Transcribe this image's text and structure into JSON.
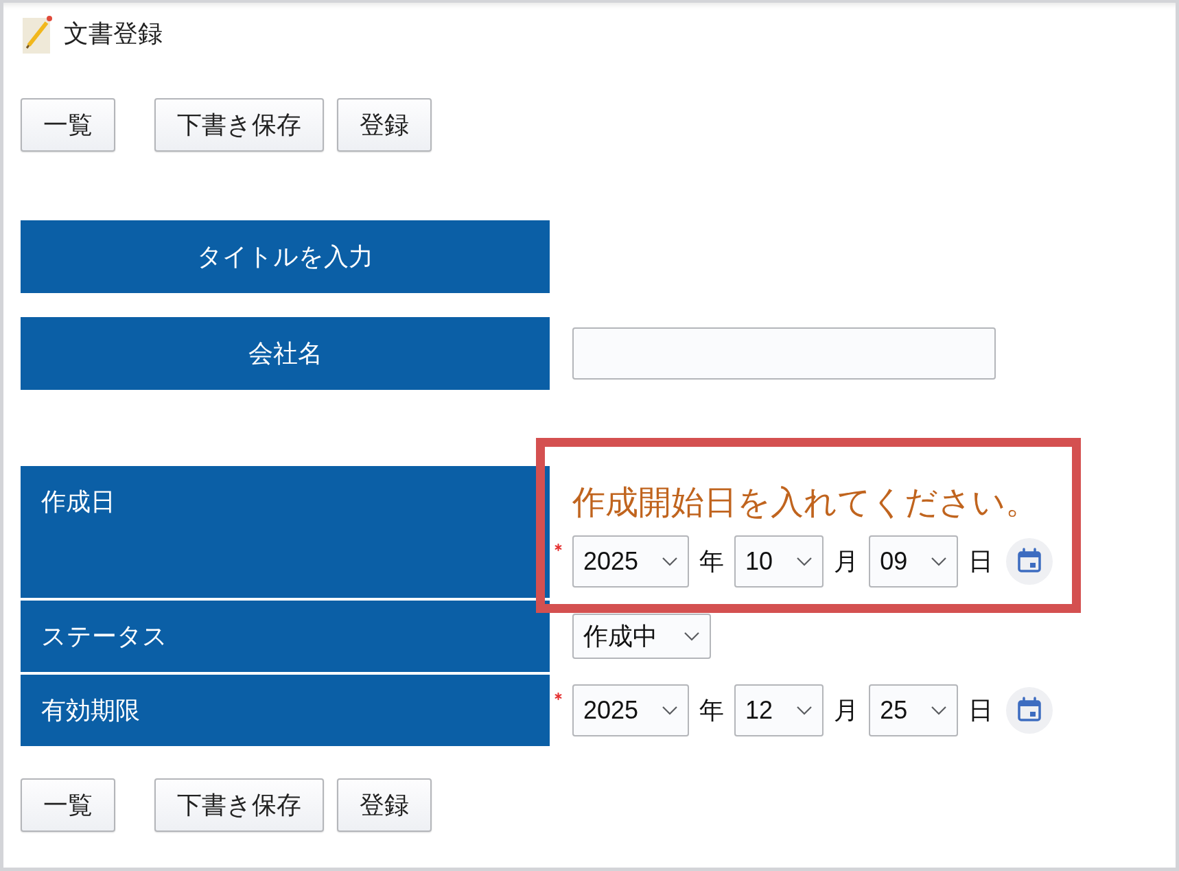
{
  "header": {
    "title": "文書登録"
  },
  "toolbar_top": {
    "buttons": [
      "一覧",
      "下書き保存",
      "登録"
    ]
  },
  "form": {
    "sections": [
      {
        "rows": [
          {
            "kind": "heading",
            "label": "タイトルを入力",
            "required": false,
            "highlighted": false
          },
          {
            "kind": "text",
            "label": "会社名",
            "required": false,
            "highlighted": false
          }
        ]
      },
      {
        "rows": [
          {
            "kind": "date",
            "label": "作成日",
            "required": true,
            "highlighted": true,
            "message": "作成開始日を入れてください。",
            "parts": [
              {
                "value": "2025",
                "unit": "年"
              },
              {
                "value": "10",
                "unit": "月"
              },
              {
                "value": "09",
                "unit": "日"
              }
            ]
          },
          {
            "kind": "select",
            "label": "ステータス",
            "required": false,
            "highlighted": false,
            "value": "作成中"
          },
          {
            "kind": "date",
            "label": "有効期限",
            "required": true,
            "highlighted": false,
            "parts": [
              {
                "value": "2025",
                "unit": "年"
              },
              {
                "value": "12",
                "unit": "月"
              },
              {
                "value": "25",
                "unit": "日"
              }
            ]
          }
        ]
      }
    ]
  },
  "toolbar_bottom": {
    "buttons": [
      "一覧",
      "下書き保存",
      "登録"
    ]
  }
}
